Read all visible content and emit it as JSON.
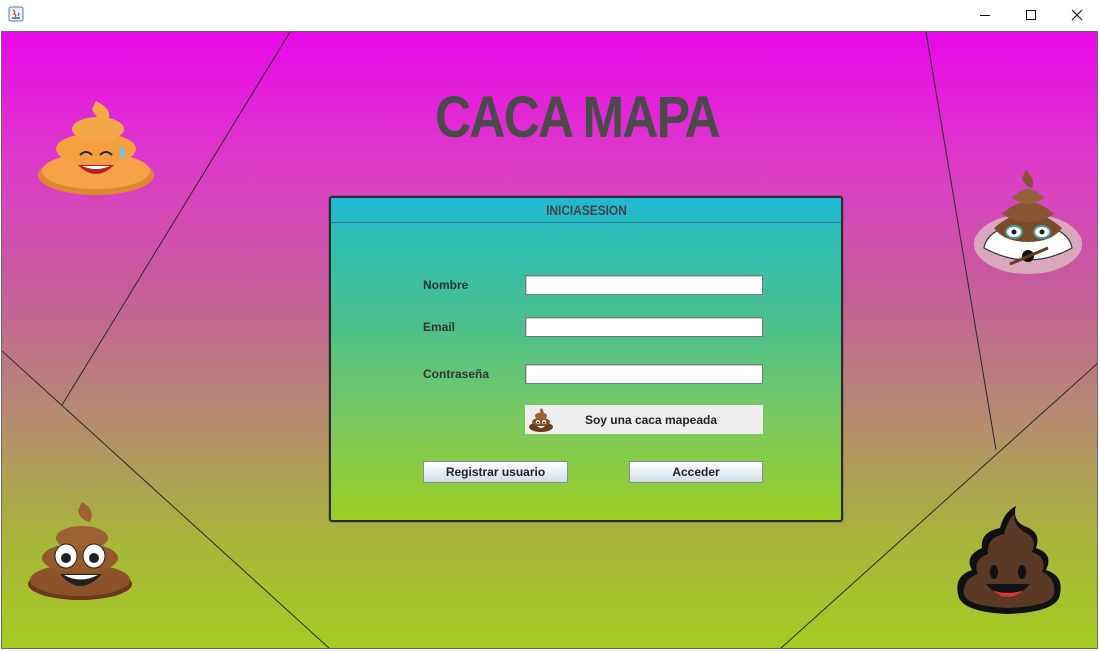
{
  "window": {
    "icon": "java-app-icon",
    "controls": {
      "minimize": "minimize-icon",
      "maximize": "maximize-icon",
      "close": "close-icon"
    }
  },
  "app": {
    "title": "CACA MAPA"
  },
  "login_panel": {
    "header": "INICIASESION",
    "fields": {
      "name_label": "Nombre",
      "name_value": "",
      "email_label": "Email",
      "email_value": "",
      "password_label": "Contraseña",
      "password_value": ""
    },
    "special_button": {
      "label": "Soy una caca mapeada",
      "icon": "poop-emoji-icon"
    },
    "register_button": "Registrar usuario",
    "login_button": "Acceder"
  },
  "decorations": {
    "top_left": "sweating-poop-emoji",
    "top_right": "cool-poop-emoji",
    "bottom_left": "smiling-poop-emoji",
    "bottom_right": "laughing-poop-emoji"
  },
  "colors": {
    "background_top": "#e808e8",
    "background_bottom": "#a6cc22",
    "panel_top": "#1fb8d8",
    "panel_bottom": "#9ccf22",
    "title_text": "#4a4a4a"
  }
}
